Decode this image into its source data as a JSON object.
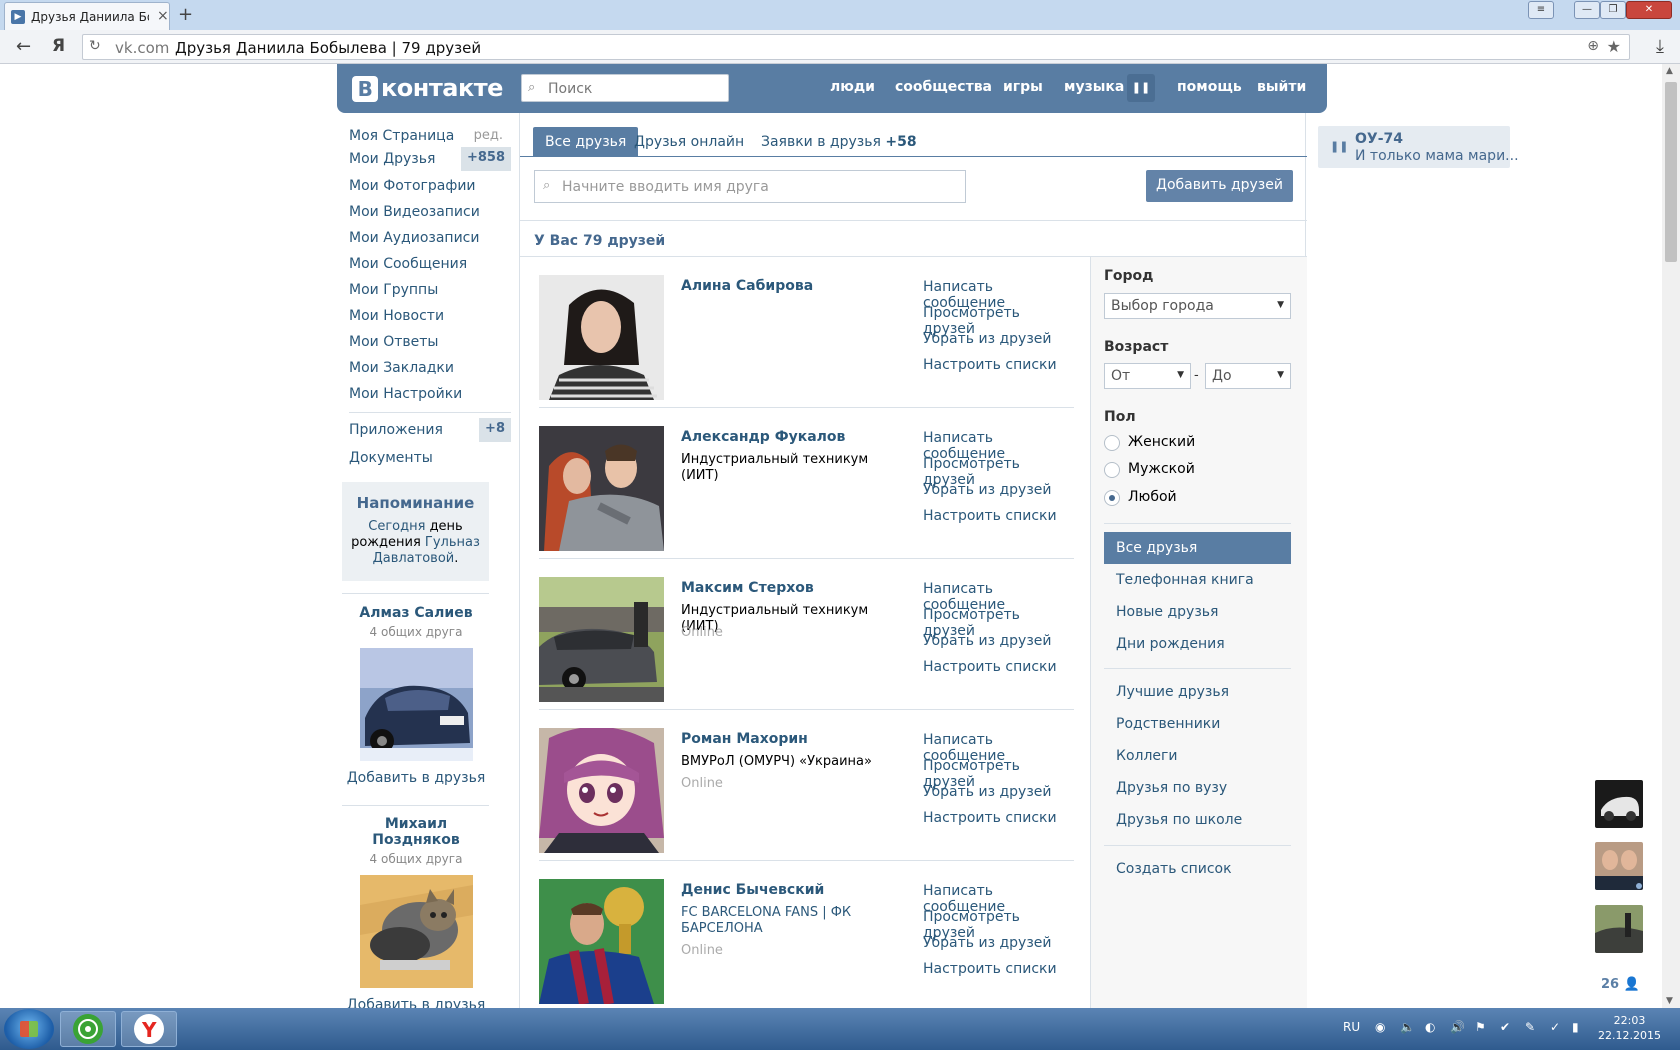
{
  "browser": {
    "tab_title": "Друзья Даниила Бобы",
    "tab_close": "×",
    "new_tab": "+",
    "domain": "vk.com",
    "page_title": "Друзья Даниила Бобылева | 79 друзей"
  },
  "header": {
    "logo_text": "контакте",
    "logo_letter": "В",
    "search_placeholder": "Поиск",
    "nav": [
      "люди",
      "сообщества",
      "игры",
      "музыка",
      "помощь",
      "выйти"
    ]
  },
  "left_menu": {
    "items": [
      {
        "label": "Моя Страница",
        "extra": "ред."
      },
      {
        "label": "Мои Друзья",
        "count": "+858"
      },
      {
        "label": "Мои Фотографии"
      },
      {
        "label": "Мои Видеозаписи"
      },
      {
        "label": "Мои Аудиозаписи"
      },
      {
        "label": "Мои Сообщения"
      },
      {
        "label": "Мои Группы"
      },
      {
        "label": "Мои Новости"
      },
      {
        "label": "Мои Ответы"
      },
      {
        "label": "Мои Закладки"
      },
      {
        "label": "Мои Настройки"
      }
    ],
    "extra_items": [
      {
        "label": "Приложения",
        "count": "+8"
      },
      {
        "label": "Документы"
      }
    ]
  },
  "reminder": {
    "title": "Напоминание",
    "today": "Сегодня",
    "text1": " день",
    "text2": "рождения ",
    "name1": "Гульназ",
    "name2": "Давлатовой",
    "dot": "."
  },
  "suggestions": [
    {
      "name": "Алмаз Салиев",
      "mutual": "4 общих друга",
      "add": "Добавить в друзья"
    },
    {
      "name": "Михаил Поздняков",
      "mutual": "4 общих друга",
      "add": "Добавить в друзья"
    }
  ],
  "tabs": [
    {
      "label": "Все друзья"
    },
    {
      "label": "Друзья онлайн"
    },
    {
      "label": "Заявки в друзья ",
      "plus": "+58"
    }
  ],
  "friend_search_placeholder": "Начните вводить имя друга",
  "add_friends_button": "Добавить друзей",
  "friends_count": "У Вас 79 друзей",
  "actions": [
    "Написать сообщение",
    "Просмотреть друзей",
    "Убрать из друзей",
    "Настроить списки"
  ],
  "friends": [
    {
      "name": "Алина Сабирова",
      "uni": "",
      "online": ""
    },
    {
      "name": "Александр Фукалов",
      "uni": "Индустриальный техникум (ИИТ)",
      "online": ""
    },
    {
      "name": "Максим Стерхов",
      "uni": "Индустриальный техникум (ИИТ)",
      "online": "Online"
    },
    {
      "name": "Роман Махорин",
      "uni": "ВМУРоЛ (ОМУРЧ) «Украина»",
      "online": "Online"
    },
    {
      "name": "Денис Бычевский",
      "uni": "FC BARCELONA FANS | ФК БАРСЕЛОНА",
      "online": "Online"
    }
  ],
  "filters": {
    "city_label": "Город",
    "city_placeholder": "Выбор города",
    "age_label": "Возраст",
    "age_from": "От",
    "age_to": "До",
    "age_dash": "-",
    "sex_label": "Пол",
    "sex_options": [
      "Женский",
      "Мужской",
      "Любой"
    ],
    "sex_selected": 2,
    "nav_main": [
      "Все друзья",
      "Телефонная книга",
      "Новые друзья",
      "Дни рождения"
    ],
    "nav_lists": [
      "Лучшие друзья",
      "Родственники",
      "Коллеги",
      "Друзья по вузу",
      "Друзья по школе"
    ],
    "create_list": "Создать список"
  },
  "player": {
    "artist": "ОУ-74",
    "song": "И только мама мари..."
  },
  "chat_count": "26",
  "taskbar": {
    "lang": "RU",
    "time": "22:03",
    "date": "22.12.2015"
  }
}
